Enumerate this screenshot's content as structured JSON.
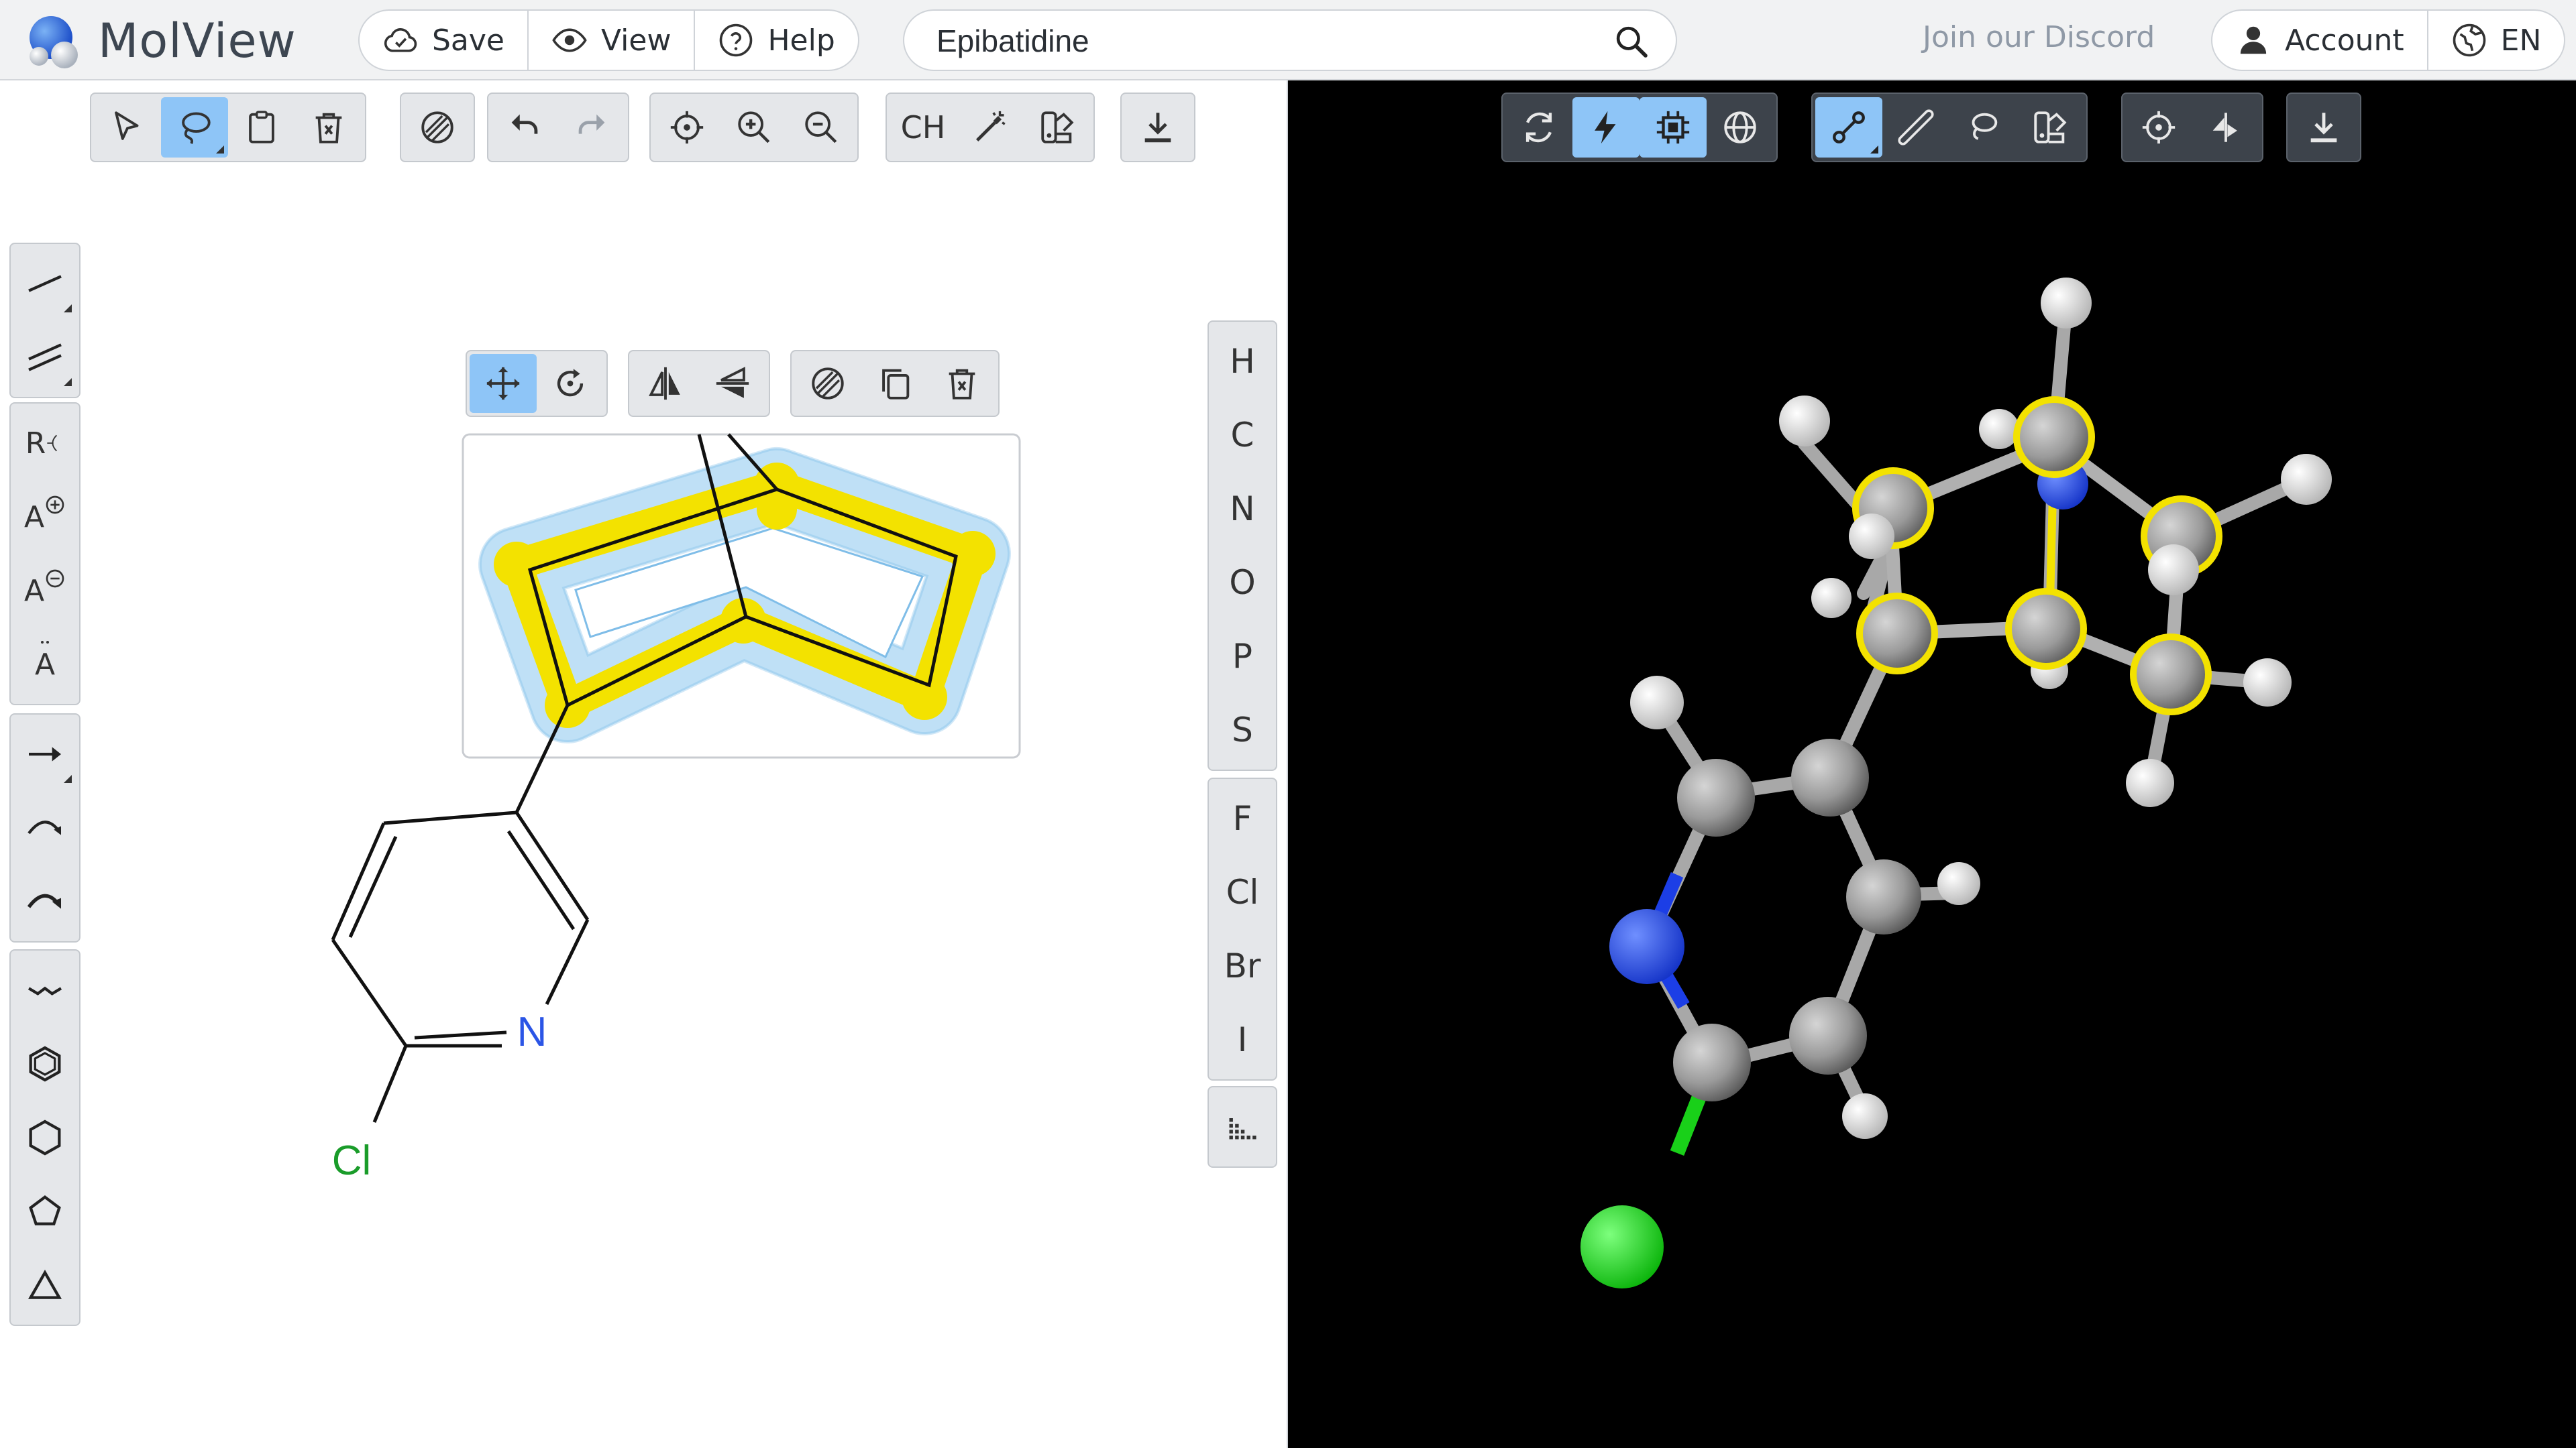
{
  "app": {
    "name": "MolView",
    "discord_link": "Join our Discord"
  },
  "header": {
    "menu": {
      "save_label": "Save",
      "view_label": "View",
      "help_label": "Help"
    },
    "search": {
      "value": "Epibatidine",
      "placeholder": ""
    },
    "account_label": "Account",
    "language_label": "EN"
  },
  "editor_toolbar": {
    "items": [
      "select-pointer",
      "lasso",
      "clipboard",
      "erase",
      "hatch-fill",
      "undo",
      "redo",
      "center",
      "zoom-in",
      "zoom-out",
      "ch-toggle",
      "clean-magic",
      "color-tool",
      "download"
    ],
    "ch_label": "CH"
  },
  "selection_toolbar": {
    "items": [
      "move",
      "rotate",
      "flip-horizontal",
      "flip-vertical",
      "hatch-fill",
      "copy",
      "delete"
    ]
  },
  "left_tools": {
    "groups": [
      [
        "single-bond",
        "double-bond"
      ],
      [
        "r-group",
        "charge-plus",
        "charge-minus",
        "lone-pair"
      ],
      [
        "arrow",
        "curved-arrow",
        "curved-arrow-2"
      ],
      [
        "chain",
        "benzene",
        "hexagon",
        "pentagon",
        "triangle"
      ]
    ],
    "r_group_label": "R",
    "atom_label": "A"
  },
  "elements": {
    "group1": [
      "H",
      "C",
      "N",
      "O",
      "P",
      "S"
    ],
    "group2": [
      "F",
      "Cl",
      "Br",
      "I"
    ]
  },
  "molecule_2d": {
    "atoms": {
      "nitrogen": "N",
      "chlorine": "Cl"
    }
  },
  "viewer_toolbar": {
    "items": [
      "rotate-reset",
      "bolt",
      "chip",
      "globe",
      "bond-tool",
      "ruler",
      "lasso-3d",
      "color-3d",
      "center-3d",
      "flip-3d",
      "download-3d"
    ]
  },
  "colors": {
    "selection_yellow": "#f3e200",
    "selection_halo": "#bfe0f6",
    "nitrogen_blue": "#2b55e6",
    "chlorine_green": "#1a9c2a",
    "active_button": "#8ec5f7"
  }
}
